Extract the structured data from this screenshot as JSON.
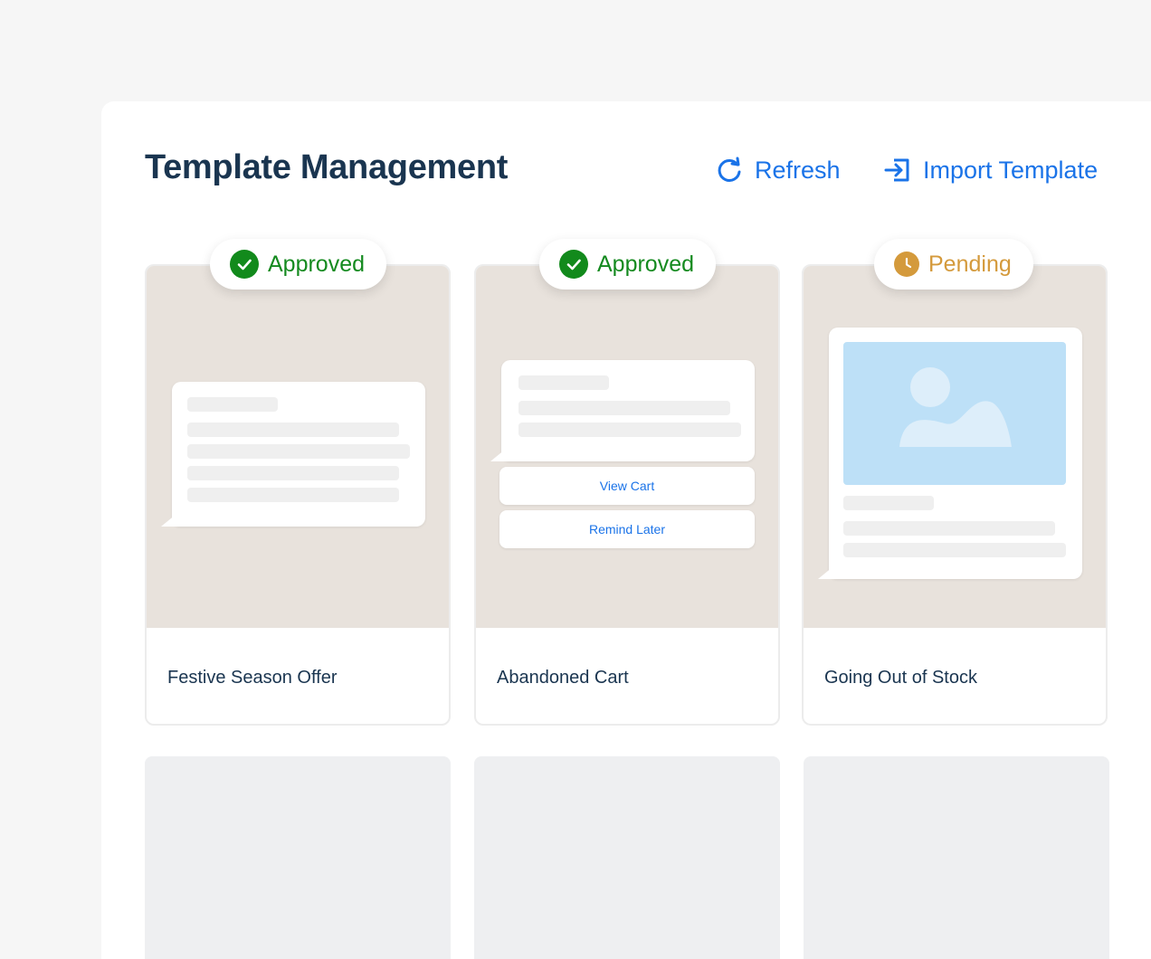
{
  "header": {
    "title": "Template Management",
    "refresh_label": "Refresh",
    "import_label": "Import Template"
  },
  "templates": [
    {
      "name": "Festive Season Offer",
      "status": "Approved",
      "status_icon": "check-circle-icon"
    },
    {
      "name": "Abandoned Cart",
      "status": "Approved",
      "status_icon": "check-circle-icon",
      "buttons": [
        "View Cart",
        "Remind Later"
      ]
    },
    {
      "name": "Going Out of Stock",
      "status": "Pending",
      "status_icon": "clock-icon"
    }
  ],
  "colors": {
    "accent": "#1a73e8",
    "approved": "#128a1c",
    "pending": "#d49a3c",
    "title": "#1a3550",
    "preview_bg": "#e8e2dc"
  }
}
